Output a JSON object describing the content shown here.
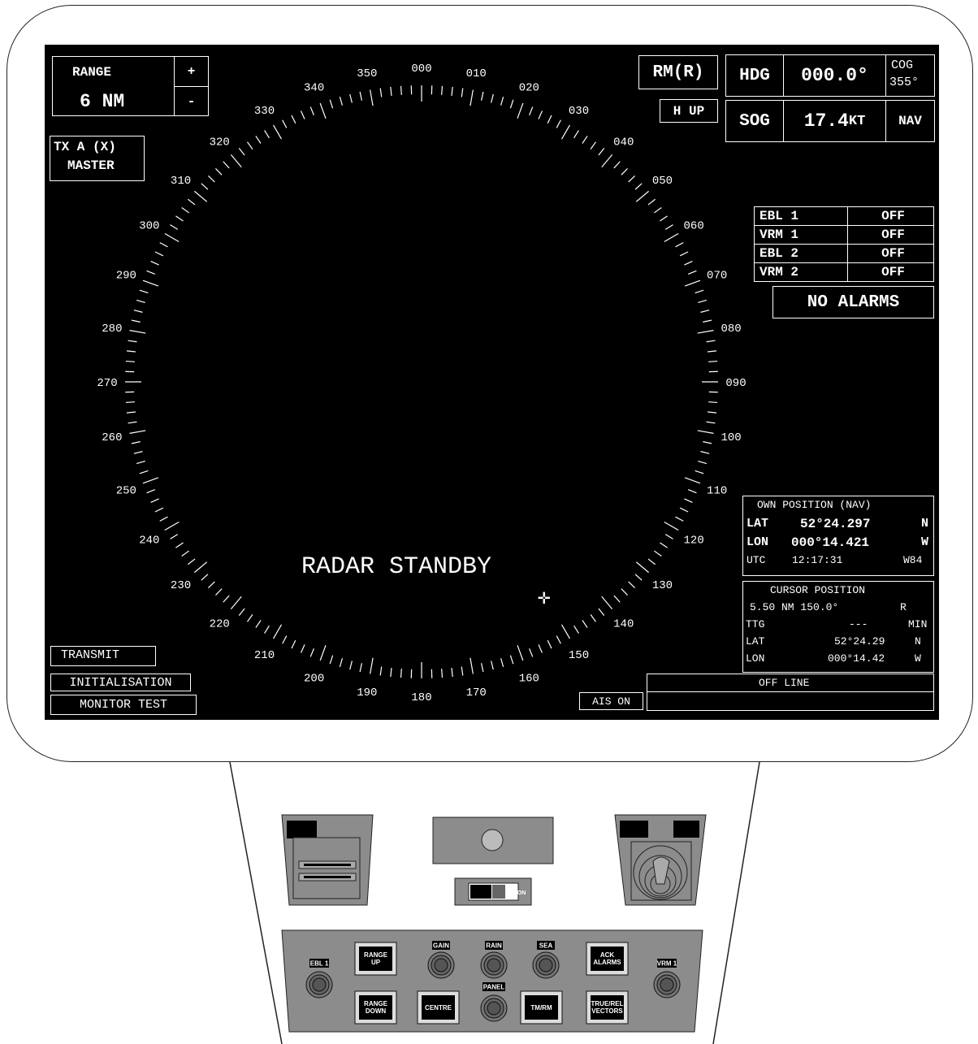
{
  "range": {
    "label": "RANGE",
    "value": "6 NM",
    "plus": "+",
    "minus": "-"
  },
  "tx": {
    "line1": "TX A (X)",
    "line2": "MASTER"
  },
  "mode": {
    "motion": "RM(R)",
    "orientation": "H UP"
  },
  "nav": {
    "hdg_label": "HDG",
    "hdg_value": "000.0°",
    "cog_label": "COG",
    "cog_value": "355°",
    "sog_label": "SOG",
    "sog_value": "17.4",
    "sog_unit": "KT",
    "source": "NAV"
  },
  "markers": [
    {
      "label": "EBL 1",
      "state": "OFF"
    },
    {
      "label": "VRM 1",
      "state": "OFF"
    },
    {
      "label": "EBL 2",
      "state": "OFF"
    },
    {
      "label": "VRM 2",
      "state": "OFF"
    }
  ],
  "alarms": "NO ALARMS",
  "status_text": "RADAR STANDBY",
  "own_position": {
    "title": "OWN POSITION (NAV)",
    "lat_label": "LAT",
    "lat_value": "52°24.297",
    "lat_hem": "N",
    "lon_label": "LON",
    "lon_value": "000°14.421",
    "lon_hem": "W",
    "utc_label": "UTC",
    "utc_value": "12:17:31",
    "datum": "W84"
  },
  "cursor_position": {
    "title": "CURSOR POSITION",
    "range_bearing": "5.50 NM  150.0°",
    "ref": "R",
    "ttg_label": "TTG",
    "ttg_value": "---",
    "ttg_unit": "MIN",
    "lat_label": "LAT",
    "lat_value": "52°24.29",
    "lat_hem": "N",
    "lon_label": "LON",
    "lon_value": "000°14.42",
    "lon_hem": "W"
  },
  "offline": "OFF LINE",
  "ais": "AIS ON",
  "menu": [
    "TRANSMIT",
    "INITIALISATION",
    "MONITOR TEST"
  ],
  "bearing_labels": [
    "000",
    "010",
    "020",
    "030",
    "040",
    "050",
    "060",
    "070",
    "080",
    "090",
    "100",
    "110",
    "120",
    "130",
    "140",
    "150",
    "160",
    "170",
    "180",
    "190",
    "200",
    "210",
    "220",
    "230",
    "240",
    "250",
    "260",
    "270",
    "280",
    "290",
    "300",
    "310",
    "320",
    "330",
    "340",
    "350"
  ],
  "panel": {
    "switch_label": "ON",
    "labels": {
      "ebl1": "EBL 1",
      "vrm1": "VRM 1",
      "gain": "GAIN",
      "rain": "RAIN",
      "sea": "SEA",
      "panel": "PANEL",
      "range_up_1": "RANGE",
      "range_up_2": "UP",
      "range_down_1": "RANGE",
      "range_down_2": "DOWN",
      "centre": "CENTRE",
      "tm_rm": "TM/RM",
      "ack_1": "ACK",
      "ack_2": "ALARMS",
      "vec_1": "TRUE/REL",
      "vec_2": "VECTORS"
    }
  },
  "colors": {
    "screen": "#000000",
    "text": "#ffffff",
    "panel": "#8c8c8c"
  }
}
